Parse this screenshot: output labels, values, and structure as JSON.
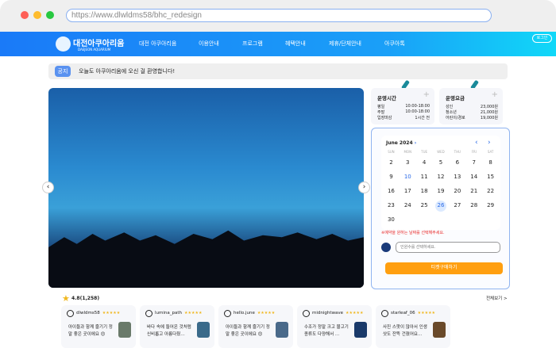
{
  "browser": {
    "url": "https://www.dlwldms58/bhc_redesign"
  },
  "nav": {
    "logo_title": "대전아쿠아리움",
    "logo_sub": "DAEJEON AQUARIUM",
    "items": [
      "대전 아쿠아리움",
      "이용안내",
      "프로그램",
      "혜택안내",
      "제휴/단체안내",
      "아쿠아톡"
    ],
    "login": "로그인"
  },
  "notice": {
    "tag": "공지",
    "message": "오늘도 아쿠아리움에 오신 걸 환영합니다!"
  },
  "hours": {
    "title": "운영시간",
    "rows": [
      [
        "평일",
        "10:00-18:00"
      ],
      [
        "주말",
        "10:00-18:00"
      ],
      [
        "입장마감",
        "1시간 전"
      ]
    ]
  },
  "fees": {
    "title": "운영요금",
    "rows": [
      [
        "성인",
        "23,000원"
      ],
      [
        "청소년",
        "21,000원"
      ],
      [
        "어린이/경로",
        "19,000원"
      ]
    ]
  },
  "calendar": {
    "month": "June 2024",
    "weekdays": [
      "SUN",
      "MON",
      "TUE",
      "WED",
      "THU",
      "FRI",
      "SAT"
    ],
    "days": [
      "2",
      "3",
      "4",
      "5",
      "6",
      "7",
      "8",
      "9",
      "10",
      "11",
      "12",
      "13",
      "14",
      "15",
      "16",
      "17",
      "18",
      "19",
      "20",
      "21",
      "22",
      "23",
      "24",
      "25",
      "26",
      "27",
      "28",
      "29",
      "30"
    ],
    "today": "10",
    "selected": "26"
  },
  "booking": {
    "warning": "※예약을 원하는 날짜를 선택해주세요.",
    "people_placeholder": "인원수를 선택하세요.",
    "buy_label": "티켓구매하기"
  },
  "reviews": {
    "rating": "4.8(1,258)",
    "more": "전체보기 >",
    "items": [
      {
        "user": "dlwldms58",
        "stars": "★★★★★",
        "text": "아이들과 함께 즐기기 정말 좋은 곳이에요 😊"
      },
      {
        "user": "lumina_path",
        "stars": "★★★★★",
        "text": "바다 속에 들어온 것처럼 신비롭고 아름다웠…"
      },
      {
        "user": "hello.june",
        "stars": "★★★★★",
        "text": "아이들과 함께 즐기기 정말 좋은 곳이에요 😊"
      },
      {
        "user": "midnightwave",
        "stars": "★★★★★",
        "text": "수조가 정말 크고 물고기 종류도 다양해서 …"
      },
      {
        "user": "starleaf_06",
        "stars": "★★★★★",
        "text": "사진 스팟이 많아서 인생샷도 잔뜩 건졌어요…"
      }
    ]
  },
  "colors": {
    "accent": "#1a7af8",
    "buy": "#ff9f10",
    "warning": "#e82a2a"
  }
}
